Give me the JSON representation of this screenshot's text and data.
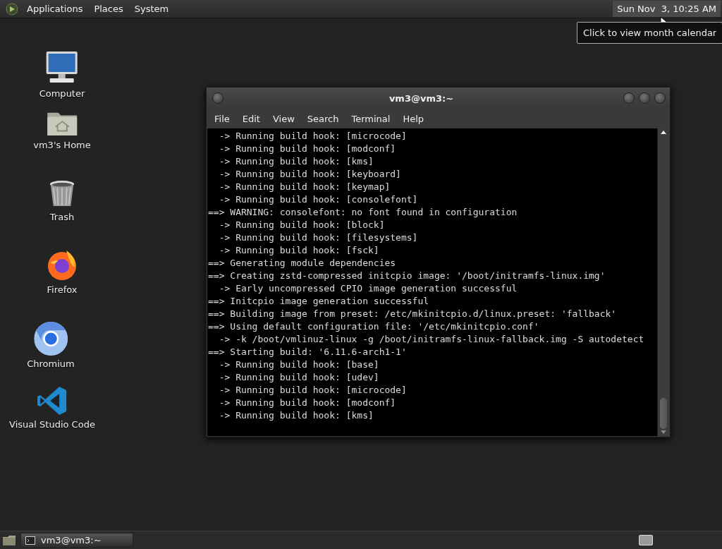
{
  "top_panel": {
    "menus": [
      "Applications",
      "Places",
      "System"
    ],
    "clock": "Sun Nov  3, 10:25 AM"
  },
  "tooltip": "Click to view month calendar",
  "desktop_icons": [
    {
      "kind": "computer",
      "label": "Computer"
    },
    {
      "kind": "home",
      "label": "vm3's Home"
    },
    {
      "kind": "trash",
      "label": "Trash"
    },
    {
      "kind": "firefox",
      "label": "Firefox"
    },
    {
      "kind": "chromium",
      "label": "Chromium"
    },
    {
      "kind": "vscode",
      "label": "Visual Studio Code"
    }
  ],
  "window": {
    "title": "vm3@vm3:~",
    "menu": [
      "File",
      "Edit",
      "View",
      "Search",
      "Terminal",
      "Help"
    ],
    "lines": [
      "  -> Running build hook: [microcode]",
      "  -> Running build hook: [modconf]",
      "  -> Running build hook: [kms]",
      "  -> Running build hook: [keyboard]",
      "  -> Running build hook: [keymap]",
      "  -> Running build hook: [consolefont]",
      "==> WARNING: consolefont: no font found in configuration",
      "  -> Running build hook: [block]",
      "  -> Running build hook: [filesystems]",
      "  -> Running build hook: [fsck]",
      "==> Generating module dependencies",
      "==> Creating zstd-compressed initcpio image: '/boot/initramfs-linux.img'",
      "  -> Early uncompressed CPIO image generation successful",
      "==> Initcpio image generation successful",
      "==> Building image from preset: /etc/mkinitcpio.d/linux.preset: 'fallback'",
      "==> Using default configuration file: '/etc/mkinitcpio.conf'",
      "  -> -k /boot/vmlinuz-linux -g /boot/initramfs-linux-fallback.img -S autodetect",
      "==> Starting build: '6.11.6-arch1-1'",
      "  -> Running build hook: [base]",
      "  -> Running build hook: [udev]",
      "  -> Running build hook: [microcode]",
      "  -> Running build hook: [modconf]",
      "  -> Running build hook: [kms]"
    ]
  },
  "taskbar": {
    "tasks": [
      "vm3@vm3:~"
    ]
  }
}
